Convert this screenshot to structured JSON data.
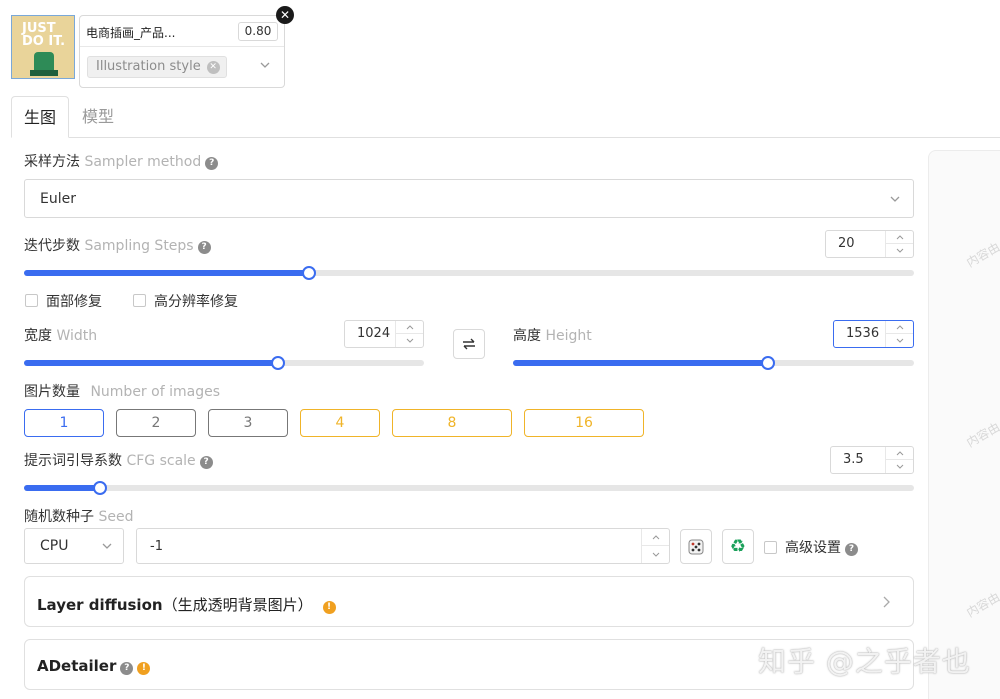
{
  "lora_card": {
    "thumbnail_text": "JUST DO IT.",
    "name": "电商插画_产品...",
    "weight": "0.80",
    "style_tag": "Illustration style"
  },
  "tabs": [
    {
      "label": "生图",
      "active": true
    },
    {
      "label": "模型",
      "active": false
    }
  ],
  "sampler": {
    "label_zh": "采样方法",
    "label_en": "Sampler method",
    "value": "Euler"
  },
  "steps": {
    "label_zh": "迭代步数",
    "label_en": "Sampling Steps",
    "value": "20",
    "fraction": 0.32
  },
  "checkboxes": {
    "face_fix": "面部修复",
    "hires_fix": "高分辨率修复"
  },
  "width": {
    "label_zh": "宽度",
    "label_en": "Width",
    "value": "1024",
    "fraction": 0.635
  },
  "height": {
    "label_zh": "高度",
    "label_en": "Height",
    "value": "1536",
    "fraction": 0.635
  },
  "num_images": {
    "label_zh": "图片数量",
    "label_en": "Number of images",
    "options": [
      "1",
      "2",
      "3",
      "4",
      "8",
      "16"
    ],
    "selected": "1"
  },
  "cfg": {
    "label_zh": "提示词引导系数",
    "label_en": "CFG scale",
    "value": "3.5",
    "fraction": 0.085
  },
  "seed": {
    "label_zh": "随机数种子",
    "label_en": "Seed",
    "device": "CPU",
    "value": "-1",
    "advanced_label": "高级设置"
  },
  "panels": {
    "layer_diffusion": {
      "title": "Layer diffusion",
      "subtitle": "（生成透明背景图片）"
    },
    "adetailer": {
      "title": "ADetailer"
    }
  },
  "watermarks": {
    "small": "内容由",
    "main": "知乎 @之乎者也"
  },
  "colors": {
    "accent": "#3a6cf0",
    "gold": "#f0b429",
    "warn": "#f0a020"
  }
}
